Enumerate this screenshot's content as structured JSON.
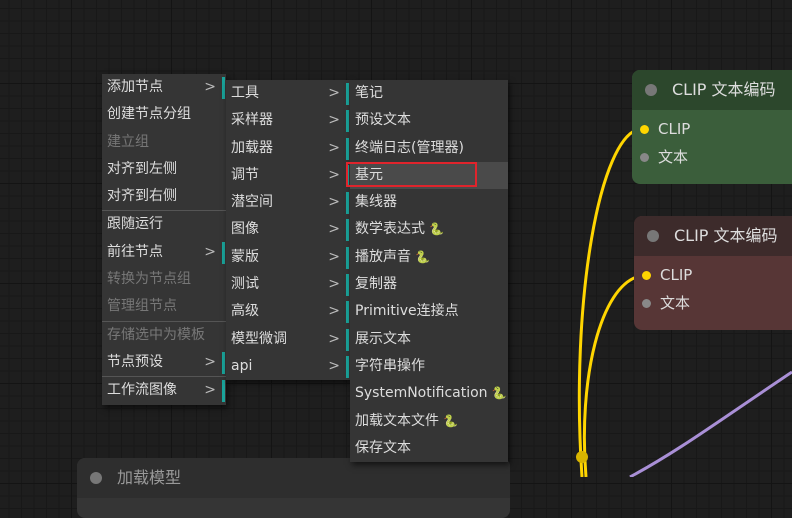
{
  "menu_main": [
    {
      "label": "添加节点",
      "sub": true
    },
    {
      "label": "创建节点分组"
    },
    {
      "label": "建立组",
      "disabled": true
    },
    {
      "label": "对齐到左侧"
    },
    {
      "label": "对齐到右侧",
      "sep": true
    },
    {
      "label": "跟随运行"
    },
    {
      "label": "前往节点",
      "sub": true
    },
    {
      "label": "转换为节点组",
      "disabled": true
    },
    {
      "label": "管理组节点",
      "disabled": true,
      "sep": true
    },
    {
      "label": "存储选中为模板",
      "disabled": true
    },
    {
      "label": "节点预设",
      "sub": true,
      "sep": true
    },
    {
      "label": "工作流图像",
      "sub": true
    }
  ],
  "menu_categories": [
    "工具",
    "采样器",
    "加载器",
    "调节",
    "潜空间",
    "图像",
    "蒙版",
    "测试",
    "高级",
    "模型微调",
    "api"
  ],
  "menu_tools": [
    {
      "label": "笔记"
    },
    {
      "label": "预设文本"
    },
    {
      "label": "终端日志(管理器)"
    },
    {
      "label": "基元",
      "highlighted": true
    },
    {
      "label": "集线器"
    },
    {
      "label": "数学表达式",
      "badge": "snake-icon"
    },
    {
      "label": "播放声音",
      "badge": "snake-icon"
    },
    {
      "label": "复制器"
    },
    {
      "label": "Primitive连接点"
    },
    {
      "label": "展示文本"
    },
    {
      "label": "字符串操作"
    },
    {
      "label": "SystemNotification",
      "badge": "snake-icon"
    },
    {
      "label": "加载文本文件",
      "badge": "snake-icon"
    },
    {
      "label": "保存文本"
    }
  ],
  "submenu_arrow": ">",
  "nodes": {
    "positive": {
      "title": "CLIP 文本编码",
      "inputs": [
        "CLIP",
        "文本"
      ]
    },
    "negative": {
      "title": "CLIP 文本编码",
      "inputs": [
        "CLIP",
        "文本"
      ]
    },
    "loader": {
      "title": "加载模型"
    }
  },
  "colors": {
    "accent": "#1aa39a",
    "highlight_border": "#e0242c",
    "clip_wire": "#ffd500",
    "purple_wire": "#a98fd6"
  }
}
